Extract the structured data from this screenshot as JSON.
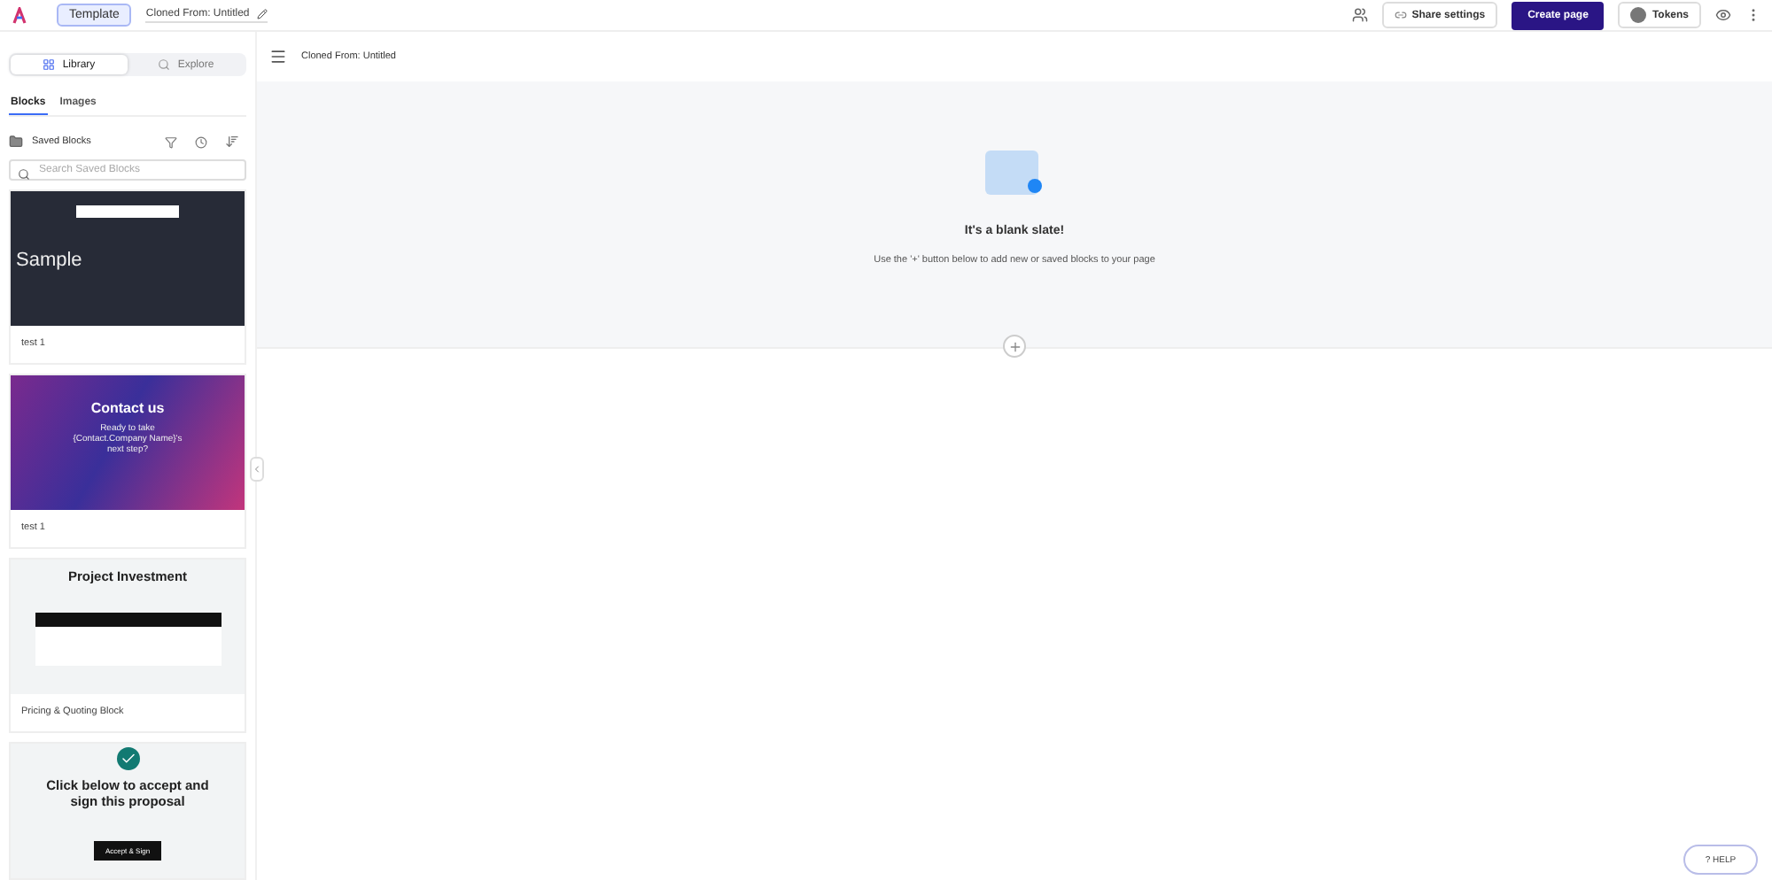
{
  "topbar": {
    "template_button": "Template",
    "document_title": "Cloned From: Untitled",
    "share_button": "Share settings",
    "create_button": "Create page",
    "tokens_button": "Tokens"
  },
  "sidebar": {
    "tabs": [
      {
        "label": "Library",
        "selected": true
      },
      {
        "label": "Explore",
        "selected": false
      }
    ],
    "subtabs": [
      {
        "label": "Blocks",
        "selected": true
      },
      {
        "label": "Images",
        "selected": false
      }
    ],
    "folder": "Saved Blocks",
    "search": {
      "placeholder": "Search Saved Blocks"
    },
    "blocks": [
      {
        "kind": "sample",
        "name": "test 1",
        "preview": {
          "title": "Sample"
        }
      },
      {
        "kind": "contact",
        "name": "test 1",
        "preview": {
          "title": "Contact us",
          "body": "Ready to take {Contact.Company Name}'s next step?"
        }
      },
      {
        "kind": "pricing",
        "name": "Pricing & Quoting Block",
        "preview": {
          "title": "Project Investment"
        }
      },
      {
        "kind": "accept",
        "preview": {
          "title": "Click below to accept and sign this proposal",
          "button": "Accept & Sign"
        }
      }
    ]
  },
  "canvas": {
    "header_title": "Cloned From: Untitled",
    "empty_title": "It's a blank slate!",
    "empty_text": "Use the '+' button below to add new or saved blocks to your page"
  },
  "help_button": "? HELP"
}
